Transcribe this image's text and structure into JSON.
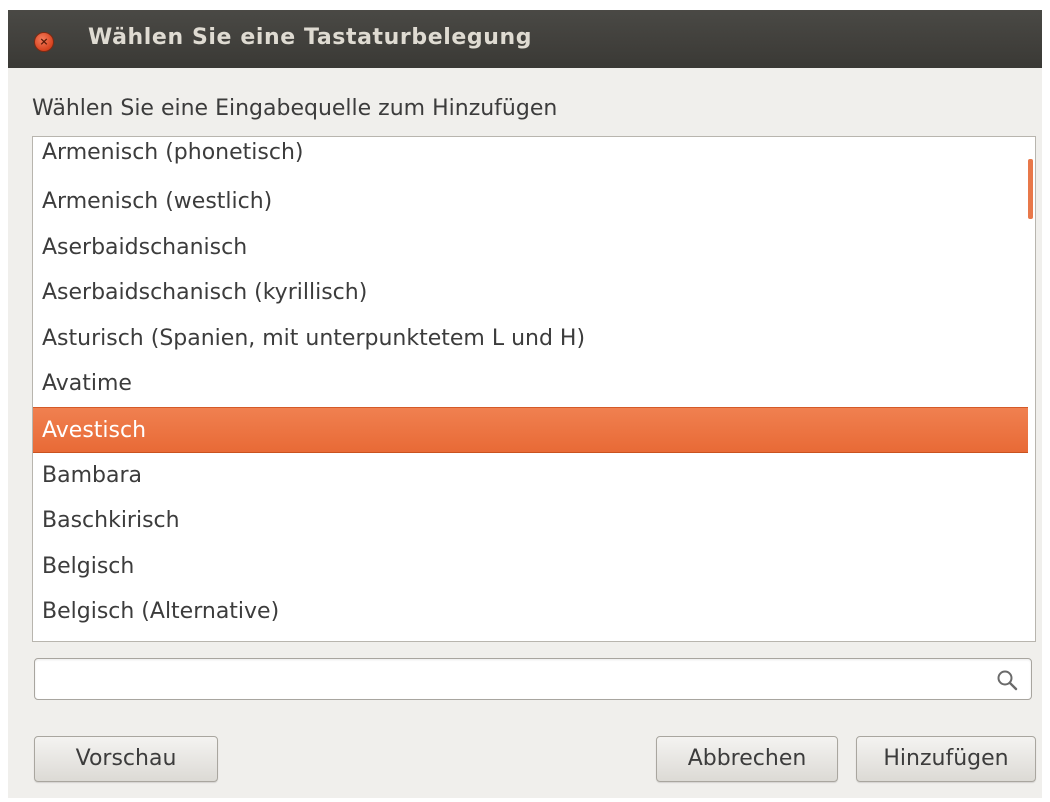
{
  "window": {
    "title": "Wählen Sie eine Tastaturbelegung",
    "close_icon": "close-icon"
  },
  "prompt": "Wählen Sie eine Eingabequelle zum Hinzufügen",
  "list": {
    "items": [
      "Armenisch (phonetisch)",
      "Armenisch (westlich)",
      "Aserbaidschanisch",
      "Aserbaidschanisch (kyrillisch)",
      "Asturisch (Spanien, mit unterpunktetem L und H)",
      "Avatime",
      "Avestisch",
      "Bambara",
      "Baschkirisch",
      "Belgisch",
      "Belgisch (Alternative)"
    ],
    "selected": "Avestisch"
  },
  "search": {
    "value": "",
    "placeholder": "",
    "icon": "search-icon"
  },
  "buttons": {
    "preview": "Vorschau",
    "cancel": "Abbrechen",
    "add": "Hinzufügen"
  },
  "colors": {
    "selection": "#e86a36",
    "titlebar": "#3c3b37",
    "window_bg": "#f0efec"
  }
}
